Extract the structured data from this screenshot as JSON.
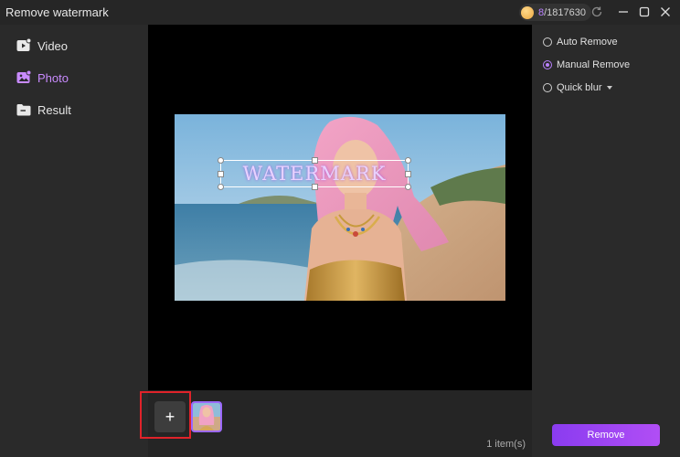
{
  "window": {
    "title": "Remove watermark",
    "credits_used": "8",
    "credits_total": "/1817630"
  },
  "sidebar": {
    "items": [
      {
        "label": "Video",
        "icon": "video-icon",
        "active": false
      },
      {
        "label": "Photo",
        "icon": "photo-icon",
        "active": true
      },
      {
        "label": "Result",
        "icon": "folder-icon",
        "active": false
      }
    ]
  },
  "canvas": {
    "watermark_text": "WATERMARK"
  },
  "thumbs": {
    "add_label": "+",
    "count_label": "1 item(s)"
  },
  "options": {
    "auto": "Auto Remove",
    "manual": "Manual Remove",
    "quick": "Quick blur",
    "selected": "Manual Remove"
  },
  "actions": {
    "remove_label": "Remove"
  },
  "colors": {
    "accent": "#b981ff",
    "highlight_box": "#e0232a"
  }
}
